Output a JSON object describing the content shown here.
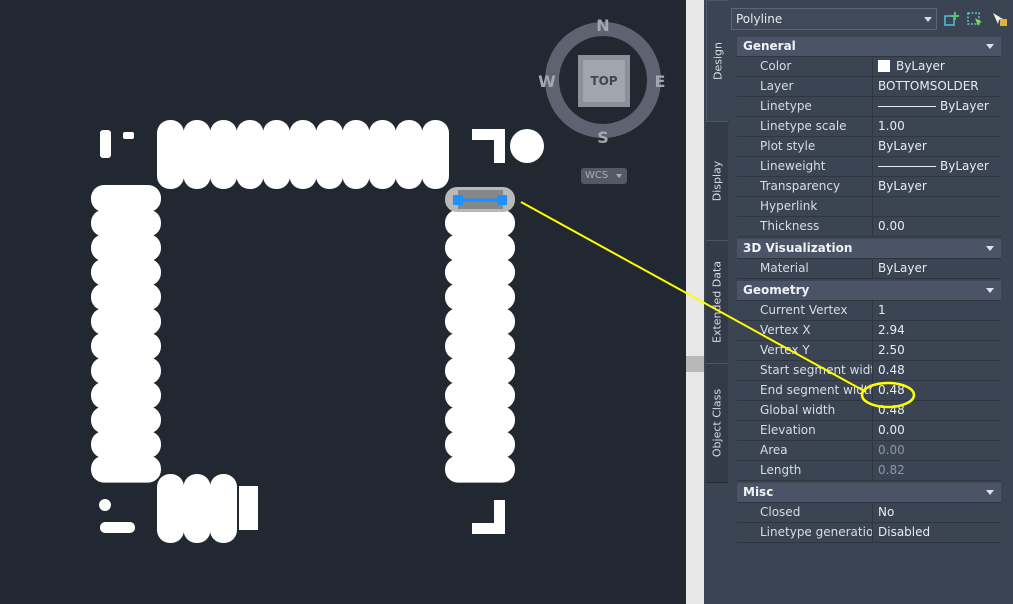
{
  "compass": {
    "n": "N",
    "s": "S",
    "e": "E",
    "w": "W",
    "top": "TOP",
    "wcs": "WCS"
  },
  "palette": {
    "object_type": "Polyline",
    "tabs": [
      "Design",
      "Display",
      "Extended Data",
      "Object Class"
    ],
    "sections": [
      {
        "title": "General",
        "rows": [
          {
            "k": "Color",
            "v": "ByLayer",
            "swatch": true
          },
          {
            "k": "Layer",
            "v": "BOTTOMSOLDER"
          },
          {
            "k": "Linetype",
            "v": "ByLayer",
            "line": true
          },
          {
            "k": "Linetype scale",
            "v": "1.00"
          },
          {
            "k": "Plot style",
            "v": "ByLayer"
          },
          {
            "k": "Lineweight",
            "v": "ByLayer",
            "line": true
          },
          {
            "k": "Transparency",
            "v": "ByLayer"
          },
          {
            "k": "Hyperlink",
            "v": ""
          },
          {
            "k": "Thickness",
            "v": "0.00"
          }
        ]
      },
      {
        "title": "3D Visualization",
        "rows": [
          {
            "k": "Material",
            "v": "ByLayer"
          }
        ]
      },
      {
        "title": "Geometry",
        "rows": [
          {
            "k": "Current Vertex",
            "v": "1"
          },
          {
            "k": "Vertex X",
            "v": "2.94"
          },
          {
            "k": "Vertex Y",
            "v": "2.50"
          },
          {
            "k": "Start segment width",
            "v": "0.48"
          },
          {
            "k": "End segment width",
            "v": "0.48"
          },
          {
            "k": "Global width",
            "v": "0.48"
          },
          {
            "k": "Elevation",
            "v": "0.00"
          },
          {
            "k": "Area",
            "v": "0.00",
            "gray": true
          },
          {
            "k": "Length",
            "v": "0.82",
            "gray": true
          }
        ]
      },
      {
        "title": "Misc",
        "rows": [
          {
            "k": "Closed",
            "v": "No"
          },
          {
            "k": "Linetype generation",
            "v": "Disabled"
          }
        ]
      }
    ]
  },
  "colors": {
    "canvas": "#222831",
    "pad": "#ffffff",
    "annotation": "#ffff00",
    "selection": "#1e90ff"
  }
}
